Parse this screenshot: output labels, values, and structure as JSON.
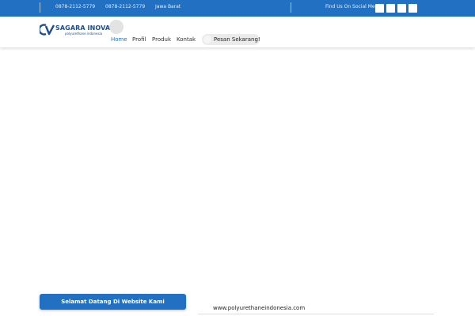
{
  "topbar": {
    "phone_1": "0878-2112-5779",
    "phone_2": "0878-2112-5779",
    "location": "Jawa Barat",
    "social_label": "Find Us On Social Media",
    "social_icons": [
      "facebook-icon",
      "twitter-icon",
      "instagram-icon",
      "youtube-icon"
    ]
  },
  "header": {
    "logo": {
      "brand": "SAGARA INOVASI",
      "tagline": "polyurethane indonesia",
      "mark_text": "CV"
    },
    "nav": [
      {
        "label": "Home",
        "active": true
      },
      {
        "label": "Profil",
        "active": false
      },
      {
        "label": "Produk",
        "active": false
      },
      {
        "label": "Kontak",
        "active": false
      }
    ],
    "order_button": "Pesan Sekarang!"
  },
  "content": {
    "welcome_button": "Selamat Datang Di Website Kami",
    "website": "www.polyurethaneindonesia.com"
  },
  "colors": {
    "primary": "#2170c1",
    "logo_blue": "#1f4e8a"
  }
}
